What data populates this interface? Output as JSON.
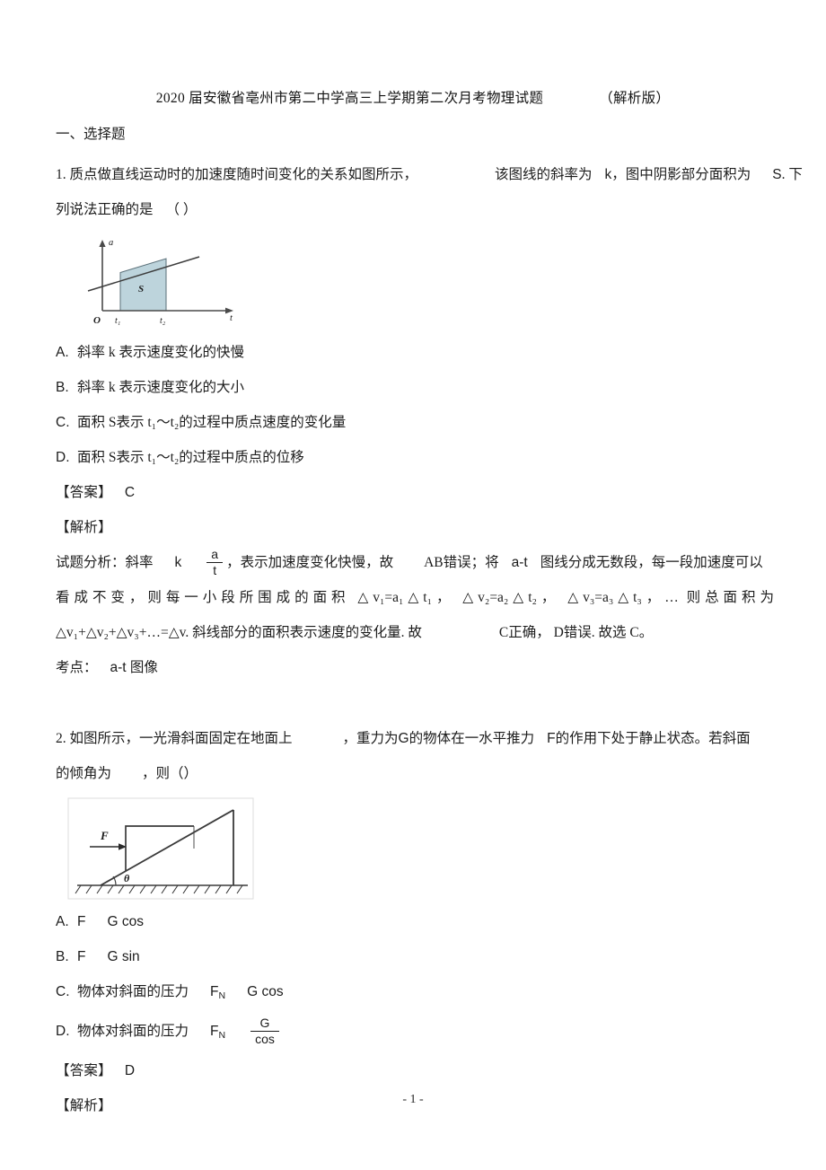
{
  "document": {
    "title": "2020 届安徽省亳州市第二中学高三上学期第二次月考物理试题",
    "version_tag": "（解析版）",
    "page_number": "- 1 -"
  },
  "section": {
    "heading": "一、选择题"
  },
  "q1": {
    "stem_part1": "1. 质点做直线运动时的加速度随时间变化的关系如图所示，",
    "stem_part2": "该图线的斜率为",
    "stem_k": "k",
    "stem_part3": "，图中阴影部分面积为",
    "stem_S": "S",
    "stem_part4": ". 下",
    "stem_line2": "列说法正确的是",
    "stem_paren": "（        ）",
    "figure": {
      "caption_y_axis": "a",
      "caption_x_axis": "t",
      "origin_label": "O",
      "tick1": "t₁",
      "tick2": "t₂",
      "shaded_label": "S",
      "shade_color": "#bdd4dc",
      "line_color": "#3a3a3a",
      "axis_color": "#4a4a4a"
    },
    "options": [
      {
        "label": "A.",
        "text": "斜率 k 表示速度变化的快慢"
      },
      {
        "label": "B.",
        "text": "斜率 k 表示速度变化的大小"
      },
      {
        "label": "C.",
        "text": "面积 S表示 t₁～t₂的过程中质点速度的变化量"
      },
      {
        "label": "D.",
        "text": "面积 S表示 t₁～t₂的过程中质点的位移"
      }
    ],
    "answer_label": "【答案】",
    "answer_value": "C",
    "analysis_label": "【解析】",
    "analysis_lead": "试题分析：斜率",
    "analysis_k": "k",
    "frac_num": "a",
    "frac_den": "t",
    "analysis_after_frac": "，表示加速度变化快慢，故",
    "analysis_ab": "AB错误；将",
    "analysis_at": "a-t",
    "analysis_tail1": "图线分成无数段，每一段加速度可以",
    "analysis_line2": "看成不变，则每一小段所围成的面积 △v₁=a₁△t₁， △v₂=a₂△t₂， △v₃=a₃△t₃，… 则总面积为",
    "analysis_line3_part1": "△v₁+△v₂+△v₃+…=△v. 斜线部分的面积表示速度的变化量. 故",
    "analysis_line3_part2": "C正确， D错误. 故选 C。",
    "kaodian_label": "考点：",
    "kaodian_value": "a-t  图像"
  },
  "q2": {
    "stem_line1_p1": "2. 如图所示，一光滑斜面固定在地面上",
    "stem_line1_p2": "，重力为",
    "stem_G": "G",
    "stem_line1_p3": "的物体在一水平推力",
    "stem_F": "F",
    "stem_line1_p4": "的作用下处于静止状态。若斜面",
    "stem_line2_p1": "的倾角为",
    "stem_line2_p2": "，则（）",
    "figure": {
      "force_label": "F",
      "angle_label": "θ",
      "line_color": "#3a3a3a",
      "border_color": "#d8d8d8"
    },
    "options": [
      {
        "label": "A.",
        "head": "",
        "expr": "F",
        "tail": "G cos",
        "kind": "plain"
      },
      {
        "label": "B.",
        "head": "",
        "expr": "F",
        "tail": "G sin",
        "kind": "plain"
      },
      {
        "label": "C.",
        "head": "物体对斜面的压力",
        "expr": "F",
        "sub": "N",
        "tail": "G cos",
        "kind": "sub"
      },
      {
        "label": "D.",
        "head": "物体对斜面的压力",
        "expr": "F",
        "sub": "N",
        "frac_num": "G",
        "frac_den": "cos",
        "kind": "frac"
      }
    ],
    "answer_label": "【答案】",
    "answer_value": "D",
    "analysis_label": "【解析】"
  }
}
